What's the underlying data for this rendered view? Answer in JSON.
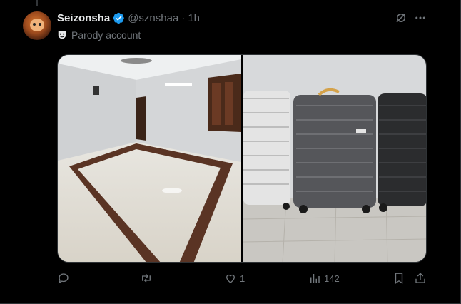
{
  "tweet": {
    "author_name": "Seizonsha",
    "handle": "@sznshaa",
    "separator": "·",
    "time": "1h",
    "label": "Parody account"
  },
  "actions": {
    "reply_count": "",
    "retweet_count": "",
    "like_count": "1",
    "views_count": "142"
  },
  "colors": {
    "verified": "#1d9bf0",
    "muted": "#71767b",
    "text": "#e7e9ea"
  },
  "icons": [
    "grok-icon",
    "more-icon",
    "theater-mask-icon",
    "reply-icon",
    "retweet-icon",
    "like-icon",
    "views-icon",
    "bookmark-icon",
    "share-icon"
  ]
}
